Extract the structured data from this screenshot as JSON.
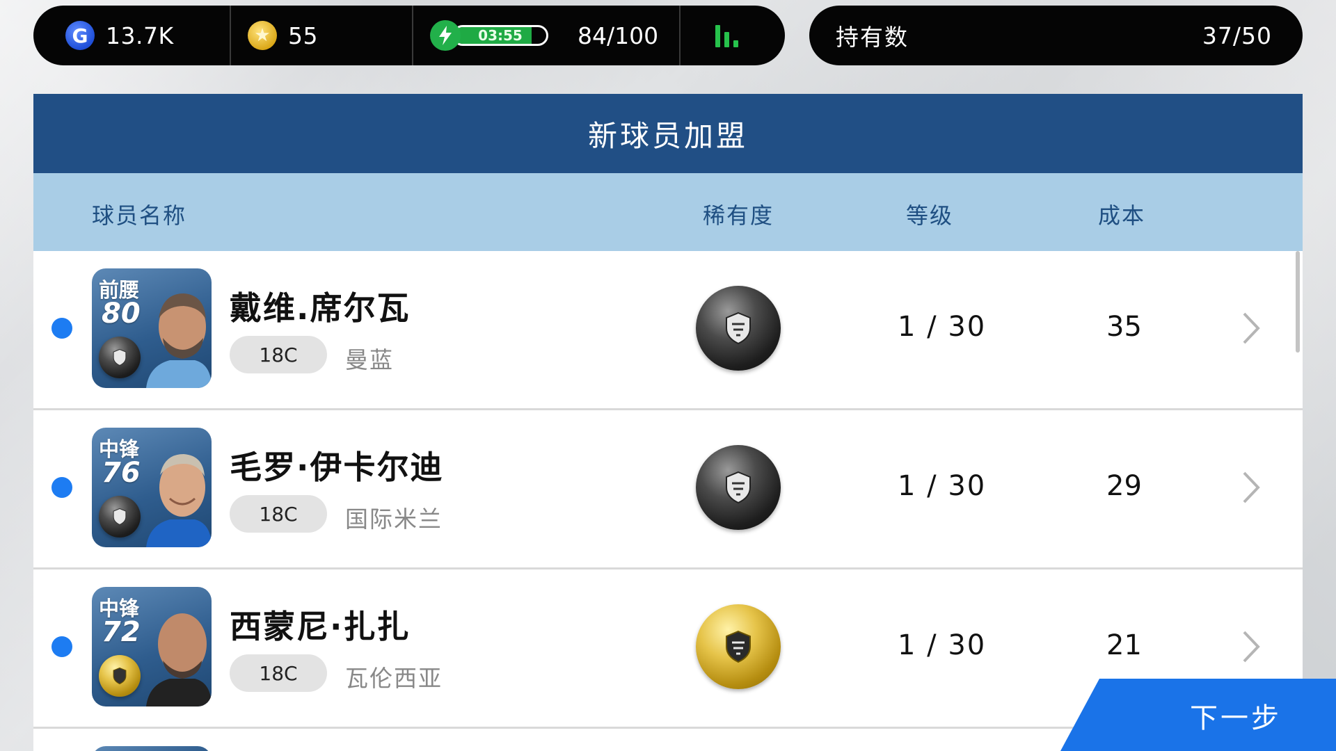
{
  "status_bar": {
    "gp_icon_letter": "G",
    "gp_value": "13.7K",
    "coin_icon_glyph": "★",
    "coin_value": "55",
    "energy_timer": "03:55",
    "energy_fill_fraction": 0.84,
    "energy_count": "84/100",
    "stats_icon": "bar-chart-icon"
  },
  "ownership": {
    "label": "持有数",
    "count": "37/50"
  },
  "panel": {
    "title": "新球员加盟",
    "columns": {
      "name": "球员名称",
      "rarity": "稀有度",
      "level": "等级",
      "cost": "成本"
    }
  },
  "players": [
    {
      "position": "前腰",
      "rating": "80",
      "name": "戴维.席尔瓦",
      "version": "18C",
      "club": "曼蓝",
      "rarity": "black",
      "level": "1 / 30",
      "cost": "35"
    },
    {
      "position": "中锋",
      "rating": "76",
      "name": "毛罗·伊卡尔迪",
      "version": "18C",
      "club": "国际米兰",
      "rarity": "black",
      "level": "1 / 30",
      "cost": "29"
    },
    {
      "position": "中锋",
      "rating": "72",
      "name": "西蒙尼·扎扎",
      "version": "18C",
      "club": "瓦伦西亚",
      "rarity": "gold",
      "level": "1 / 30",
      "cost": "21"
    }
  ],
  "next_button": {
    "label": "下一步"
  },
  "colors": {
    "title_bar": "#214f85",
    "header_bar": "#a9cde6",
    "selection_dot": "#1d7cf2",
    "next_button": "#1a73e8",
    "energy_green": "#1faa44"
  }
}
